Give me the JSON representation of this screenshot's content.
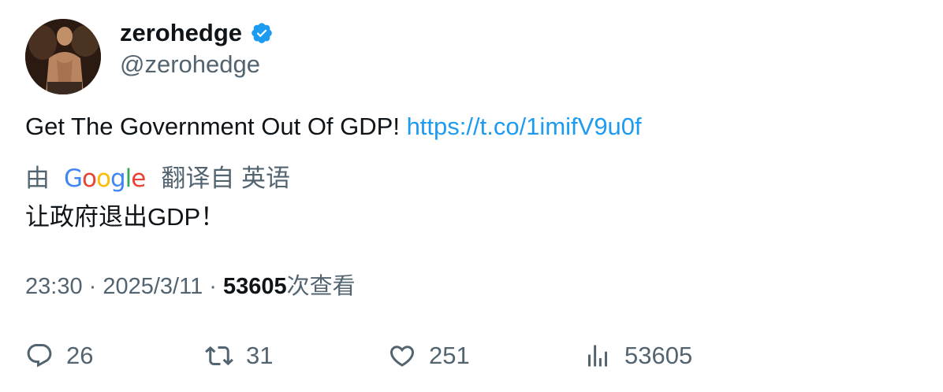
{
  "author": {
    "display_name": "zerohedge",
    "handle": "@zerohedge",
    "verified": true,
    "verified_color": "#1d9bf0"
  },
  "tweet": {
    "text": "Get The Government Out Of GDP! ",
    "link": "https://t.co/1imifV9u0f",
    "link_color": "#1d9bf0"
  },
  "translation": {
    "prefix": "由",
    "provider": "Google",
    "suffix": "翻译自 英语",
    "text": "让政府退出GDP！"
  },
  "meta": {
    "time": "23:30",
    "sep1": " · ",
    "date": "2025/3/11",
    "sep2": " · ",
    "views": "53605",
    "views_label": "次查看"
  },
  "actions": {
    "replies": "26",
    "retweets": "31",
    "likes": "251",
    "views": "53605"
  },
  "icons": [
    "verified-badge-icon",
    "reply-icon",
    "retweet-icon",
    "like-icon",
    "views-icon"
  ]
}
